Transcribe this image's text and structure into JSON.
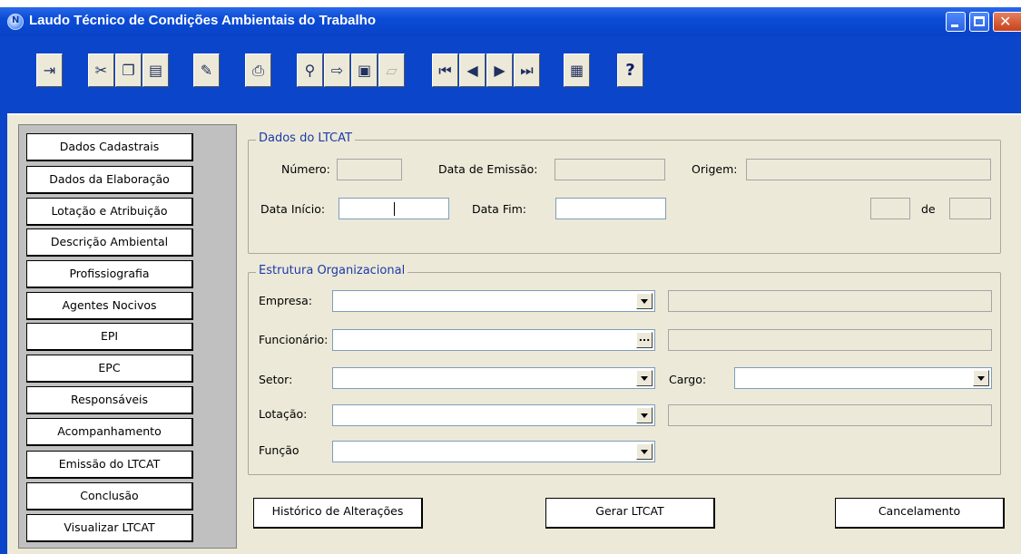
{
  "window": {
    "title": "Laudo Técnico de Condições Ambientais do Trabalho"
  },
  "toolbar": {
    "buttons": [
      {
        "icon": "exit-icon",
        "glyph": "⇥"
      },
      {
        "icon": "cut-icon",
        "glyph": "✂"
      },
      {
        "icon": "copy-icon",
        "glyph": "❐"
      },
      {
        "icon": "paste-icon",
        "glyph": "📋"
      },
      {
        "icon": "new-record-icon",
        "glyph": "✎"
      },
      {
        "icon": "print-icon",
        "glyph": "⎙"
      },
      {
        "icon": "search-icon",
        "glyph": "🔍"
      },
      {
        "icon": "open-icon",
        "glyph": "⇨"
      },
      {
        "icon": "save-icon",
        "glyph": "💾"
      },
      {
        "icon": "disabled-edit-icon",
        "glyph": "▱"
      },
      {
        "icon": "first-record-icon",
        "glyph": "⏮"
      },
      {
        "icon": "previous-record-icon",
        "glyph": "◀"
      },
      {
        "icon": "next-record-icon",
        "glyph": "▶"
      },
      {
        "icon": "last-record-icon",
        "glyph": "⏭"
      },
      {
        "icon": "calculator-icon",
        "glyph": "▦"
      },
      {
        "icon": "help-icon",
        "glyph": "?"
      }
    ]
  },
  "nav": {
    "items": [
      "Dados Cadastrais",
      "Dados da Elaboração",
      "Lotação e Atribuição",
      "Descrição Ambiental",
      "Profissiografia",
      "Agentes Nocivos",
      "EPI",
      "EPC",
      "Responsáveis",
      "Acompanhamento",
      "Emissão do LTCAT",
      "Conclusão",
      "Visualizar LTCAT"
    ]
  },
  "dados_ltcat": {
    "legend": "Dados do LTCAT",
    "numero_label": "Número:",
    "numero_value": "",
    "data_emissao_label": "Data de Emissão:",
    "data_emissao_value": "",
    "origem_label": "Origem:",
    "origem_value": "",
    "data_inicio_label": "Data Início:",
    "data_inicio_value": "",
    "data_fim_label": "Data Fim:",
    "data_fim_value": "",
    "page_current": "",
    "de_label": "de",
    "page_total": ""
  },
  "estrutura": {
    "legend": "Estrutura Organizacional",
    "empresa_label": "Empresa:",
    "funcionario_label": "Funcionário:",
    "setor_label": "Setor:",
    "cargo_label": "Cargo:",
    "lotacao_label": "Lotação:",
    "funcao_label": "Função"
  },
  "actions": {
    "historico": "Histórico de Alterações",
    "gerar": "Gerar LTCAT",
    "cancelamento": "Cancelamento"
  }
}
